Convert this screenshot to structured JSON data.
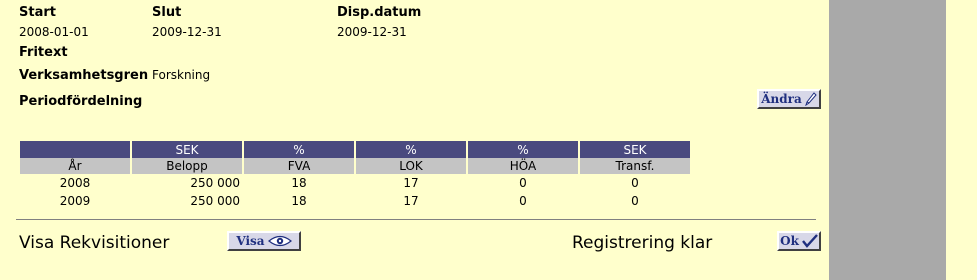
{
  "fields": {
    "start_label": "Start",
    "start_value": "2008-01-01",
    "slut_label": "Slut",
    "slut_value": "2009-12-31",
    "disp_label": "Disp.datum",
    "disp_value": "2009-12-31",
    "fritext_label": "Fritext",
    "verksamhet_label": "Verksamhetsgren",
    "verksamhet_value": "Forskning",
    "period_label": "Periodfördelning"
  },
  "buttons": {
    "andra": "Ändra",
    "visa": "Visa",
    "ok": "Ok"
  },
  "table": {
    "units": [
      "",
      "SEK",
      "%",
      "%",
      "%",
      "SEK"
    ],
    "headers": [
      "År",
      "Belopp",
      "FVA",
      "LOK",
      "HÖA",
      "Transf."
    ],
    "rows": [
      [
        "2008",
        "250 000",
        "18",
        "17",
        "0",
        "0"
      ],
      [
        "2009",
        "250 000",
        "18",
        "17",
        "0",
        "0"
      ]
    ]
  },
  "footer": {
    "visa_rekvisitioner": "Visa Rekvisitioner",
    "registrering_klar": "Registrering klar"
  },
  "colors": {
    "background": "#ffffcc",
    "side_panel": "#a9a9a9",
    "table_unit_row": "#4a4a7f",
    "table_header_row": "#c4c4c4"
  },
  "icons": {
    "andra": "pencil-icon",
    "visa": "eye-icon",
    "ok": "checkmark-icon"
  }
}
